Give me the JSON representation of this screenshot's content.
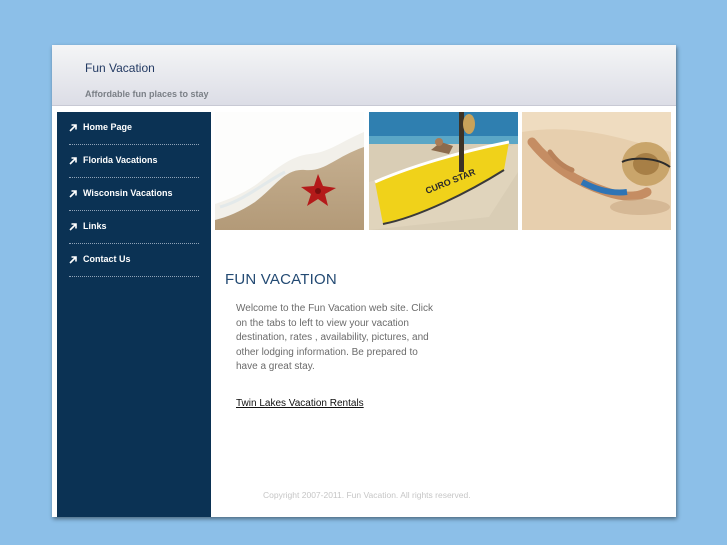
{
  "header": {
    "site_title": "Fun Vacation",
    "tagline": "Affordable fun places to stay"
  },
  "sidebar": {
    "items": [
      {
        "label": "Home Page"
      },
      {
        "label": "Florida Vacations"
      },
      {
        "label": "Wisconsin Vacations"
      },
      {
        "label": "Links"
      },
      {
        "label": "Contact Us"
      }
    ]
  },
  "photos": {
    "boat_text": "CURO STAR"
  },
  "main": {
    "heading": "FUN VACATION",
    "welcome_text": "Welcome to the Fun Vacation web site. Click on the tabs to left to view your vacation destination, rates , availability, pictures, and other lodging information. Be prepared to have a great stay.",
    "link_label": "Twin Lakes Vacation Rentals"
  },
  "footer": {
    "copyright": "Copyright 2007-2011.  Fun Vacation.  All rights reserved."
  },
  "colors": {
    "page_background": "#8cbfe8",
    "sidebar": "#0b3254",
    "heading": "#234a73"
  }
}
